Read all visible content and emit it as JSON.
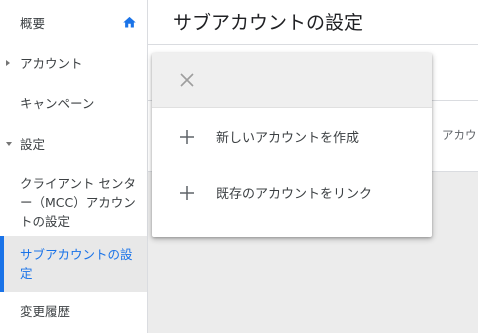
{
  "sidebar": {
    "items": [
      {
        "label": "概要"
      },
      {
        "label": "アカウント"
      },
      {
        "label": "キャンペーン"
      },
      {
        "label": "設定"
      },
      {
        "label": "クライアント センター（MCC）アカウントの設定"
      },
      {
        "label": "サブアカウントの設定"
      },
      {
        "label": "変更履歴"
      }
    ]
  },
  "header": {
    "title": "サブアカウントの設定"
  },
  "background": {
    "column_header": "アカウ"
  },
  "menu": {
    "items": [
      {
        "label": "新しいアカウントを作成"
      },
      {
        "label": "既存のアカウントをリンク"
      }
    ]
  },
  "colors": {
    "accent": "#1a73e8",
    "text": "#3c4043",
    "icon": "#757575"
  }
}
